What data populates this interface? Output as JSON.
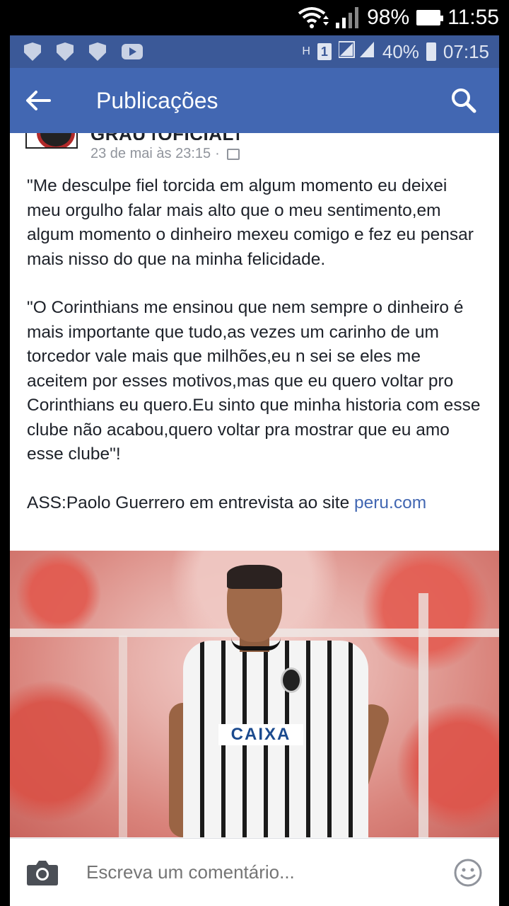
{
  "device_status": {
    "battery": "98%",
    "time": "11:55"
  },
  "inner_status": {
    "battery": "40%",
    "time": "07:15",
    "sim_badge": "1",
    "network_letter": "H"
  },
  "appbar": {
    "title": "Publicações"
  },
  "post": {
    "page_name": "GRAU [OFICIAL]",
    "timestamp": "23 de mai às 23:15",
    "separator": "·",
    "paragraph_1": "\"Me desculpe fiel torcida em algum momento eu deixei meu orgulho falar mais alto que o meu sentimento,em algum momento o dinheiro mexeu comigo e fez eu pensar mais nisso do que na minha felicidade.",
    "paragraph_2": "\"O Corinthians me ensinou que nem sempre o dinheiro é mais importante que tudo,as vezes um carinho de um torcedor vale mais que milhões,eu n sei se eles me aceitem por esses motivos,mas que eu quero voltar pro Corinthians eu quero.Eu sinto que minha historia com esse clube não acabou,quero voltar pra mostrar que eu amo esse clube\"!",
    "signature_prefix": "ASS:Paolo Guerrero em entrevista ao site ",
    "signature_link": "peru.com",
    "photo_sponsor": "CAIXA"
  },
  "comment": {
    "placeholder": "Escreva um comentário..."
  },
  "colors": {
    "facebook_blue": "#4267b2",
    "status_blue": "#3b5998",
    "link_blue": "#4267b2"
  }
}
